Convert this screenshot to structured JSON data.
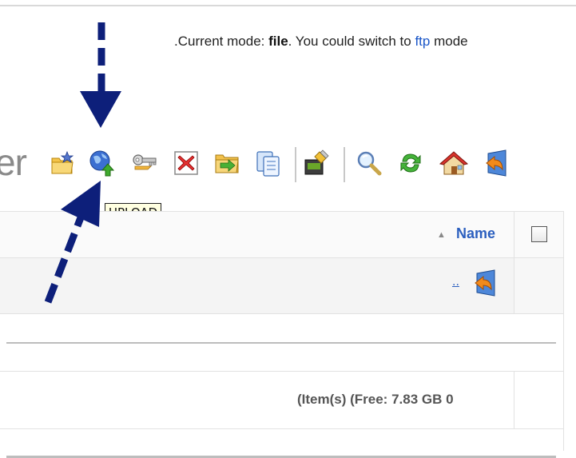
{
  "mode": {
    "prefix": ".Current mode: ",
    "current": "file",
    "middle": ". You could switch to ",
    "switch_link": "ftp",
    "suffix": " mode"
  },
  "toolbar": {
    "title_fragment": "er",
    "icons": [
      "new-folder-icon",
      "upload-icon",
      "rename-key-icon",
      "delete-icon",
      "move-icon",
      "copy-icon",
      "edit-tools-icon",
      "search-icon",
      "refresh-icon",
      "home-icon",
      "back-icon"
    ]
  },
  "tooltip": {
    "text": "UPLOAD"
  },
  "table": {
    "sort_indicator": "▲",
    "name_header": "Name",
    "parent_link": "..",
    "free_info": "(Item(s) (Free: 7.83 GB 0"
  },
  "colors": {
    "link": "#2b5fbf",
    "arrow": "#0d1f7a",
    "tooltip_bg": "#ffffe1"
  }
}
